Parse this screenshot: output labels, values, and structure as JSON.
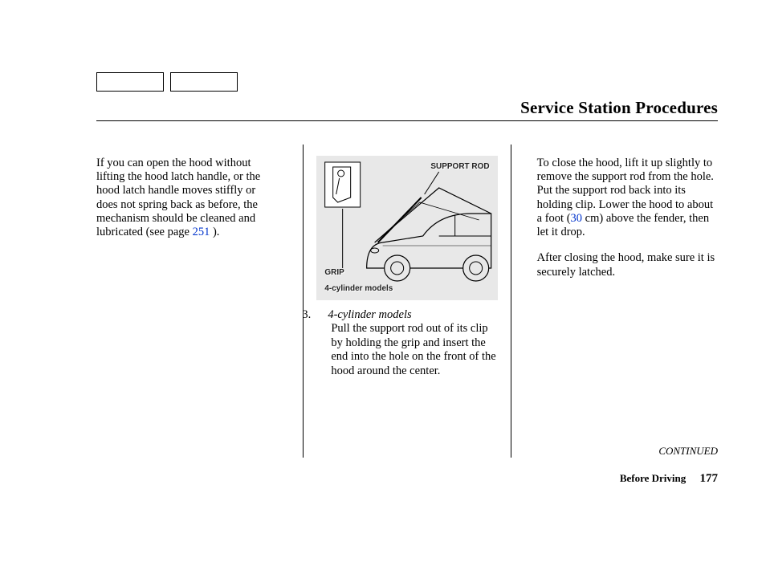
{
  "header": {
    "title": "Service Station Procedures"
  },
  "col1": {
    "para1_pre": "If you can open the hood without lifting the hood latch handle, or the hood latch handle moves stiffly or does not spring back as before, the mechanism should be cleaned and lubricated (see page ",
    "page_link": "251",
    "para1_post": " )."
  },
  "diagram": {
    "label_support_rod": "SUPPORT ROD",
    "label_grip": "GRIP",
    "caption": "4-cylinder models"
  },
  "col2": {
    "step_num": "3.",
    "step_title": "4-cylinder models",
    "step_body": "Pull the support rod out of its clip by holding the grip and insert the end into the hole on the front of the hood around the center."
  },
  "col3": {
    "para1_pre": "To close the hood, lift it up slightly to remove the support rod from the hole. Put the support rod back into its holding clip. Lower the hood to about a foot (",
    "link_30": "30",
    "para1_post": " cm) above the fender, then let it drop.",
    "para2": "After closing the hood, make sure it is securely latched."
  },
  "continued": "CONTINUED",
  "footer": {
    "section": "Before Driving",
    "page": "177"
  }
}
